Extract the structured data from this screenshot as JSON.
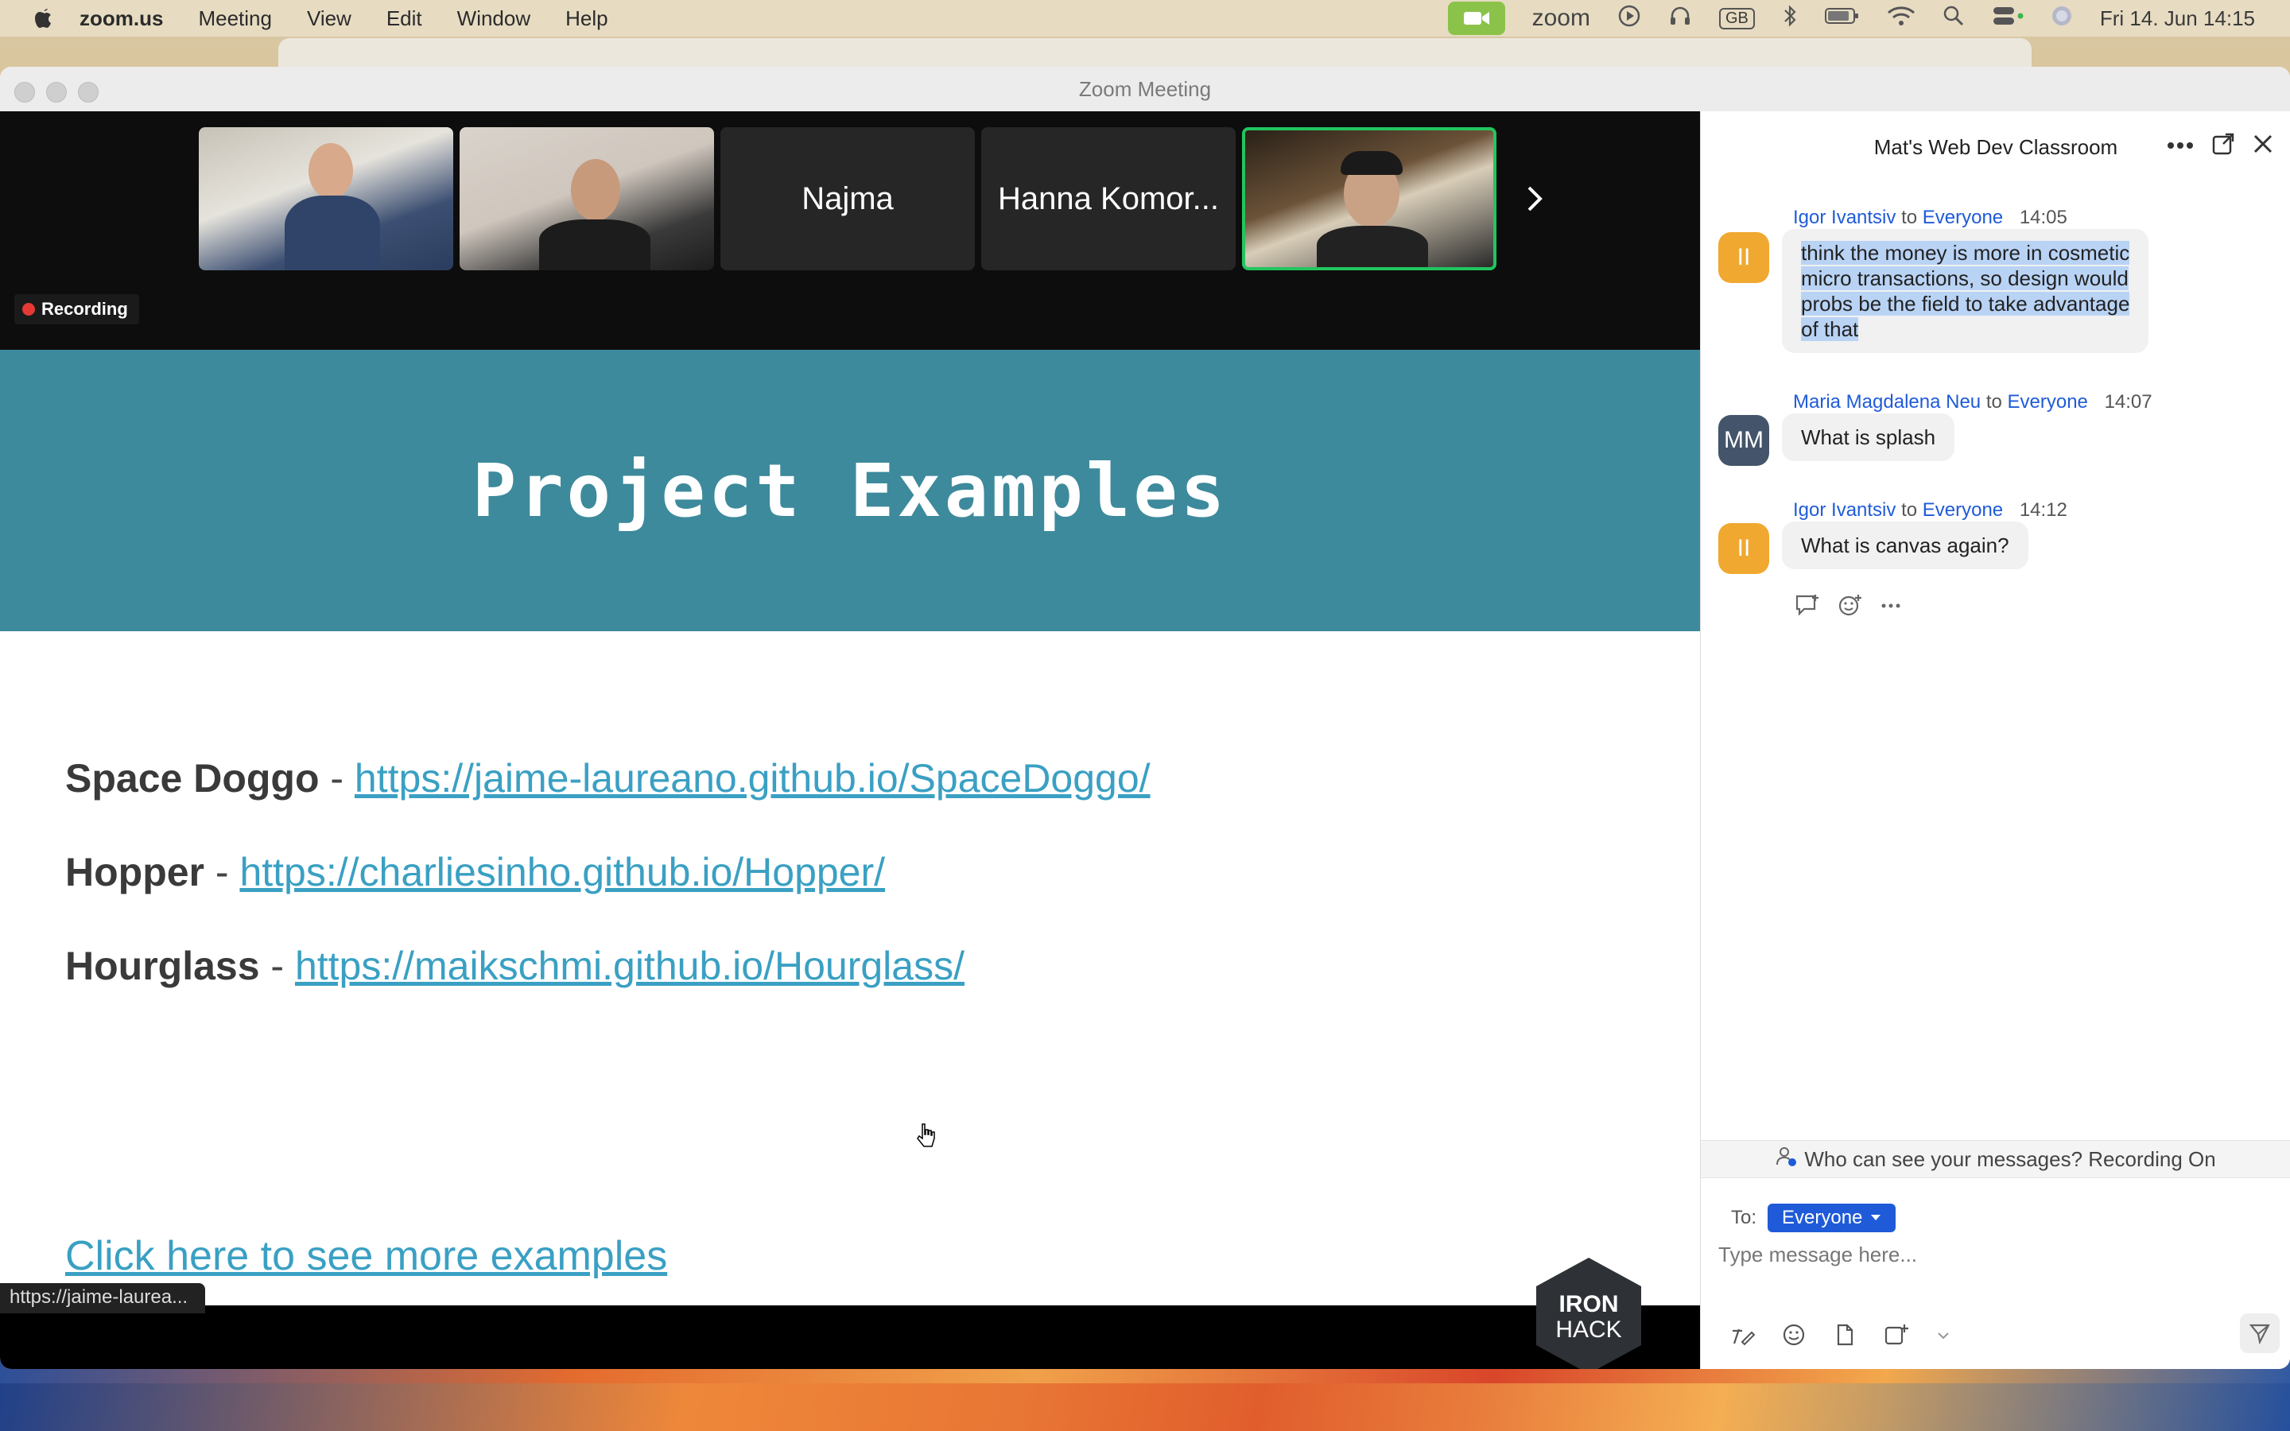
{
  "menubar": {
    "app": "zoom.us",
    "items": [
      "Meeting",
      "View",
      "Edit",
      "Window",
      "Help"
    ],
    "status_zoom": "zoom",
    "keyboard": "GB",
    "clock": "Fri 14. Jun  14:15"
  },
  "window": {
    "title": "Zoom Meeting"
  },
  "participants": [
    {
      "name": "",
      "video": true
    },
    {
      "name": "",
      "video": true
    },
    {
      "name": "Najma",
      "video": false
    },
    {
      "name": "Hanna Komor...",
      "video": false
    },
    {
      "name": "",
      "video": true,
      "active_speaker": true
    }
  ],
  "recording": {
    "label": "Recording"
  },
  "slide": {
    "title": "Project Examples",
    "projects": [
      {
        "name": "Space Doggo",
        "sep": " - ",
        "url": "https://jaime-laureano.github.io/SpaceDoggo/"
      },
      {
        "name": "Hopper",
        "sep": " - ",
        "url": "https://charliesinho.github.io/Hopper/"
      },
      {
        "name": "Hourglass",
        "sep": " - ",
        "url": "https://maikschmi.github.io/Hourglass/"
      }
    ],
    "more_link": "Click here to see more examples",
    "logo_line1": "IRON",
    "logo_line2": "HACK",
    "status_url": "https://jaime-laurea..."
  },
  "chat": {
    "title": "Mat's Web Dev Classroom",
    "messages": [
      {
        "avatar": "II",
        "avatar_color": "#f0a830",
        "sender": "Igor Ivantsiv",
        "to_word": "to",
        "recipient": "Everyone",
        "time": "14:05",
        "lines": [
          "think the money is more in cosmetic",
          "micro transactions, so design would",
          "probs be the field to take advantage",
          "of that"
        ]
      },
      {
        "avatar": "MM",
        "avatar_color": "#44546a",
        "sender": "Maria Magdalena Neu",
        "to_word": "to",
        "recipient": "Everyone",
        "time": "14:07",
        "lines": [
          "What is splash"
        ]
      },
      {
        "avatar": "II",
        "avatar_color": "#f0a830",
        "sender": "Igor Ivantsiv",
        "to_word": "to",
        "recipient": "Everyone",
        "time": "14:12",
        "lines": [
          "What is canvas again?"
        ]
      }
    ],
    "notice": "Who can see your messages? Recording On",
    "to_label": "To:",
    "to_value": "Everyone",
    "input_placeholder": "Type message here..."
  },
  "colors": {
    "slide_band": "#3d8a9c",
    "link": "#3aa0c3",
    "chat_accent": "#1f5bd8",
    "active_speaker_border": "#22c55e",
    "recording_dot": "#e53935"
  }
}
